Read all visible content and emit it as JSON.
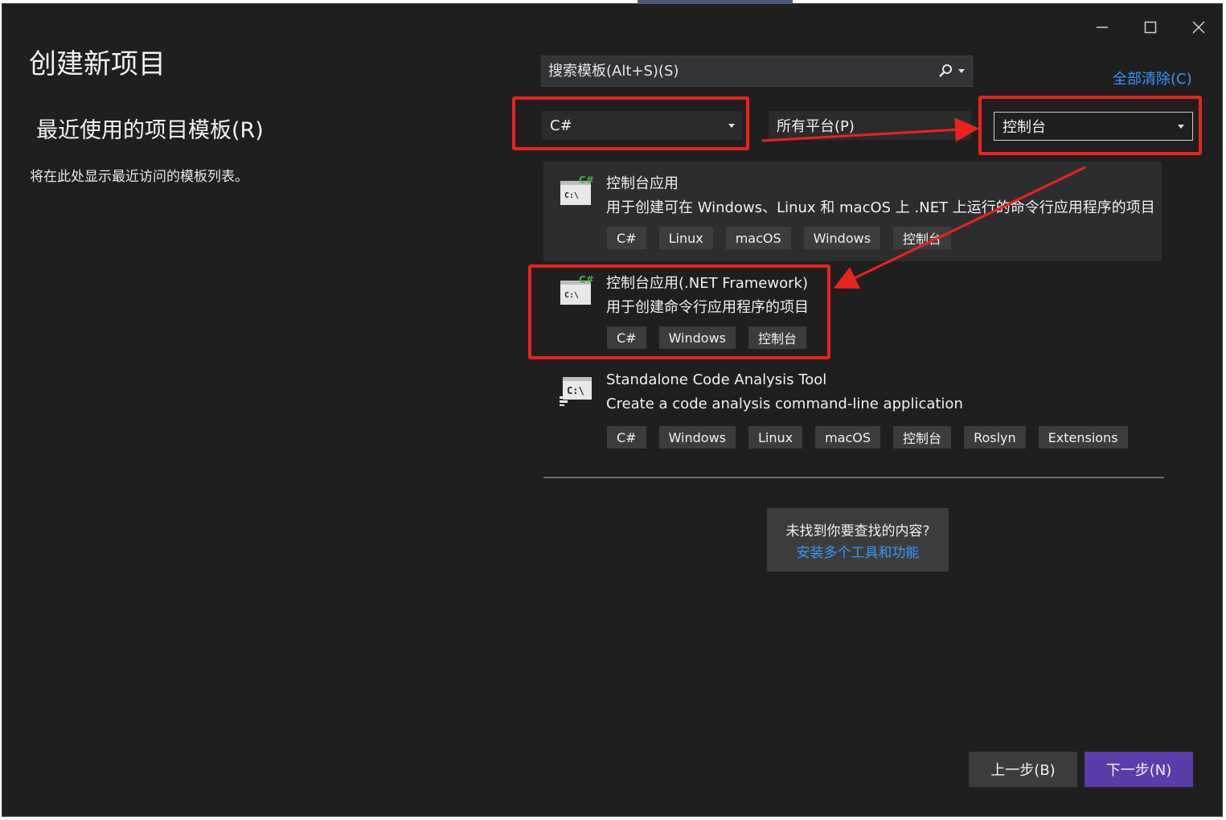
{
  "window": {
    "title": "创建新项目",
    "controls": {
      "minimize": "minimize-icon",
      "maximize": "maximize-icon",
      "close": "close-icon"
    }
  },
  "left": {
    "recent_title": "最近使用的项目模板(R)",
    "recent_empty": "将在此处显示最近访问的模板列表。"
  },
  "search": {
    "placeholder": "搜索模板(Alt+S)(S)",
    "icon": "search-icon"
  },
  "clear_all": "全部清除(C)",
  "filters": {
    "language": "C#",
    "platform": "所有平台(P)",
    "project_type": "控制台"
  },
  "templates": [
    {
      "name": "控制台应用",
      "description": "用于创建可在 Windows、Linux 和 macOS 上 .NET 上运行的命令行应用程序的项目",
      "tags": [
        "C#",
        "Linux",
        "macOS",
        "Windows",
        "控制台"
      ]
    },
    {
      "name": "控制台应用(.NET Framework)",
      "description": "用于创建命令行应用程序的项目",
      "tags": [
        "C#",
        "Windows",
        "控制台"
      ]
    },
    {
      "name": "Standalone Code Analysis Tool",
      "description": "Create a code analysis command-line application",
      "tags": [
        "C#",
        "Windows",
        "Linux",
        "macOS",
        "控制台",
        "Roslyn",
        "Extensions"
      ]
    }
  ],
  "not_found": {
    "question": "未找到你要查找的内容?",
    "link": "安装多个工具和功能"
  },
  "buttons": {
    "back": "上一步(B)",
    "next": "下一步(N)"
  },
  "colors": {
    "background": "#1f1f1f",
    "accent": "#5c3ca8",
    "link": "#3794ff",
    "annotation": "#e8231f"
  }
}
